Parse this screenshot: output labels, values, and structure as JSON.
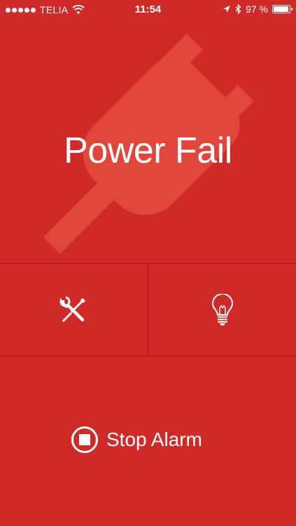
{
  "status_bar": {
    "carrier": "TELIA",
    "time": "11:54",
    "battery_text": "97 %",
    "battery_level": 0.97,
    "icons": [
      "signal-dots",
      "wifi-icon",
      "location-arrow-icon",
      "bluetooth-icon",
      "battery-icon"
    ]
  },
  "hero": {
    "title": "Power Fail",
    "background_icon": "plug-icon"
  },
  "actions": {
    "left_icon": "tools-icon",
    "right_icon": "lightbulb-icon"
  },
  "stop": {
    "label": "Stop Alarm",
    "icon": "stop-icon"
  },
  "colors": {
    "background": "#cf2a28",
    "plug": "#e0473a",
    "divider": "#a51a1a",
    "foreground": "#ffffff"
  }
}
